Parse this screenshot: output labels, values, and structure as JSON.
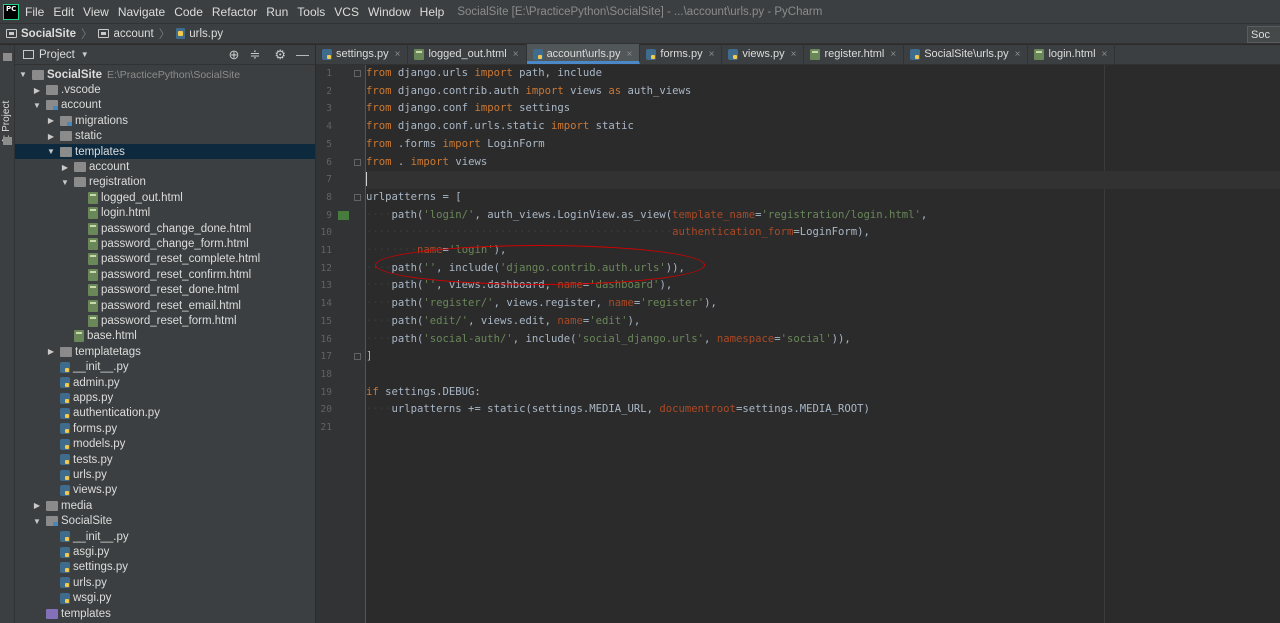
{
  "window": {
    "app_logo": "PC",
    "menu": [
      "File",
      "Edit",
      "View",
      "Navigate",
      "Code",
      "Refactor",
      "Run",
      "Tools",
      "VCS",
      "Window",
      "Help"
    ],
    "title": "SocialSite [E:\\PracticePython\\SocialSite] - ...\\account\\urls.py - PyCharm"
  },
  "navbar": {
    "project": "SocialSite",
    "folder": "account",
    "file": "urls.py",
    "right_label": "Soc"
  },
  "toolstrip": {
    "label": "1: Project"
  },
  "project_panel": {
    "header": "Project",
    "tree": [
      {
        "label": "SocialSite",
        "path": "E:\\PracticePython\\SocialSite",
        "type": "folder",
        "level": 0,
        "arrow": "down",
        "bold": true
      },
      {
        "label": ".vscode",
        "type": "folder",
        "level": 1,
        "arrow": "right"
      },
      {
        "label": "account",
        "type": "module",
        "level": 1,
        "arrow": "down"
      },
      {
        "label": "migrations",
        "type": "module",
        "level": 2,
        "arrow": "right"
      },
      {
        "label": "static",
        "type": "folder",
        "level": 2,
        "arrow": "right"
      },
      {
        "label": "templates",
        "type": "folder",
        "level": 2,
        "arrow": "down",
        "selected": true
      },
      {
        "label": "account",
        "type": "folder",
        "level": 3,
        "arrow": "right"
      },
      {
        "label": "registration",
        "type": "folder",
        "level": 3,
        "arrow": "down"
      },
      {
        "label": "logged_out.html",
        "type": "html",
        "level": 4
      },
      {
        "label": "login.html",
        "type": "html",
        "level": 4
      },
      {
        "label": "password_change_done.html",
        "type": "html",
        "level": 4
      },
      {
        "label": "password_change_form.html",
        "type": "html",
        "level": 4
      },
      {
        "label": "password_reset_complete.html",
        "type": "html",
        "level": 4
      },
      {
        "label": "password_reset_confirm.html",
        "type": "html",
        "level": 4
      },
      {
        "label": "password_reset_done.html",
        "type": "html",
        "level": 4
      },
      {
        "label": "password_reset_email.html",
        "type": "html",
        "level": 4
      },
      {
        "label": "password_reset_form.html",
        "type": "html",
        "level": 4
      },
      {
        "label": "base.html",
        "type": "html",
        "level": 3
      },
      {
        "label": "templatetags",
        "type": "folder",
        "level": 2,
        "arrow": "right"
      },
      {
        "label": "__init__.py",
        "type": "py",
        "level": 2
      },
      {
        "label": "admin.py",
        "type": "py",
        "level": 2
      },
      {
        "label": "apps.py",
        "type": "py",
        "level": 2
      },
      {
        "label": "authentication.py",
        "type": "py",
        "level": 2
      },
      {
        "label": "forms.py",
        "type": "py",
        "level": 2
      },
      {
        "label": "models.py",
        "type": "py",
        "level": 2
      },
      {
        "label": "tests.py",
        "type": "py",
        "level": 2
      },
      {
        "label": "urls.py",
        "type": "py",
        "level": 2
      },
      {
        "label": "views.py",
        "type": "py",
        "level": 2
      },
      {
        "label": "media",
        "type": "folder",
        "level": 1,
        "arrow": "right"
      },
      {
        "label": "SocialSite",
        "type": "module",
        "level": 1,
        "arrow": "down"
      },
      {
        "label": "__init__.py",
        "type": "py",
        "level": 2
      },
      {
        "label": "asgi.py",
        "type": "py",
        "level": 2
      },
      {
        "label": "settings.py",
        "type": "py",
        "level": 2
      },
      {
        "label": "urls.py",
        "type": "py",
        "level": 2
      },
      {
        "label": "wsgi.py",
        "type": "py",
        "level": 2
      },
      {
        "label": "templates",
        "type": "purple",
        "level": 1
      }
    ]
  },
  "tabs": [
    {
      "label": "settings.py",
      "type": "py"
    },
    {
      "label": "logged_out.html",
      "type": "html"
    },
    {
      "label": "account\\urls.py",
      "type": "py",
      "active": true
    },
    {
      "label": "forms.py",
      "type": "py"
    },
    {
      "label": "views.py",
      "type": "py"
    },
    {
      "label": "register.html",
      "type": "html"
    },
    {
      "label": "SocialSite\\urls.py",
      "type": "py"
    },
    {
      "label": "login.html",
      "type": "html"
    }
  ],
  "editor": {
    "lines": [
      [
        [
          "kw",
          "from"
        ],
        [
          "plain",
          " django.urls "
        ],
        [
          "kw",
          "import"
        ],
        [
          "plain",
          " path, include"
        ]
      ],
      [
        [
          "kw",
          "from"
        ],
        [
          "plain",
          " django.contrib.auth "
        ],
        [
          "kw",
          "import"
        ],
        [
          "plain",
          " views "
        ],
        [
          "kw",
          "as"
        ],
        [
          "plain",
          " auth_views"
        ]
      ],
      [
        [
          "kw",
          "from"
        ],
        [
          "plain",
          " django.conf "
        ],
        [
          "kw",
          "import"
        ],
        [
          "plain",
          " settings"
        ]
      ],
      [
        [
          "kw",
          "from"
        ],
        [
          "plain",
          " django.conf.urls.static "
        ],
        [
          "kw",
          "import"
        ],
        [
          "plain",
          " static"
        ]
      ],
      [
        [
          "kw",
          "from"
        ],
        [
          "plain",
          " .forms "
        ],
        [
          "kw",
          "import"
        ],
        [
          "plain",
          " LoginForm"
        ]
      ],
      [
        [
          "kw",
          "from"
        ],
        [
          "plain",
          " . "
        ],
        [
          "kw",
          "import"
        ],
        [
          "plain",
          " views"
        ]
      ],
      [],
      [
        [
          "plain",
          "urlpatterns = ["
        ]
      ],
      [
        [
          "dots",
          "····"
        ],
        [
          "plain",
          "path("
        ],
        [
          "str",
          "'login/'"
        ],
        [
          "plain",
          ", auth_views.LoginView.as_view("
        ],
        [
          "param",
          "template_name"
        ],
        [
          "plain",
          "="
        ],
        [
          "str",
          "'registration/login.html'"
        ],
        [
          "plain",
          ","
        ]
      ],
      [
        [
          "dots",
          "················································"
        ],
        [
          "param",
          "authentication_form"
        ],
        [
          "plain",
          "=LoginForm),"
        ]
      ],
      [
        [
          "dots",
          "········"
        ],
        [
          "param",
          "name"
        ],
        [
          "plain",
          "="
        ],
        [
          "str",
          "'login'"
        ],
        [
          "plain",
          "),"
        ]
      ],
      [
        [
          "dots",
          "····"
        ],
        [
          "plain",
          "path("
        ],
        [
          "str",
          "''"
        ],
        [
          "plain",
          ", include("
        ],
        [
          "str",
          "'django.contrib.auth.urls'"
        ],
        [
          "plain",
          ")),"
        ]
      ],
      [
        [
          "dots",
          "····"
        ],
        [
          "plain",
          "path("
        ],
        [
          "str",
          "''"
        ],
        [
          "plain",
          ", views.dashboard, "
        ],
        [
          "param",
          "name"
        ],
        [
          "plain",
          "="
        ],
        [
          "str",
          "'dashboard'"
        ],
        [
          "plain",
          "),"
        ]
      ],
      [
        [
          "dots",
          "····"
        ],
        [
          "plain",
          "path("
        ],
        [
          "str",
          "'register/'"
        ],
        [
          "plain",
          ", views.register, "
        ],
        [
          "param",
          "name"
        ],
        [
          "plain",
          "="
        ],
        [
          "str",
          "'register'"
        ],
        [
          "plain",
          "),"
        ]
      ],
      [
        [
          "dots",
          "····"
        ],
        [
          "plain",
          "path("
        ],
        [
          "str",
          "'edit/'"
        ],
        [
          "plain",
          ", views.edit, "
        ],
        [
          "param",
          "name"
        ],
        [
          "plain",
          "="
        ],
        [
          "str",
          "'edit'"
        ],
        [
          "plain",
          "),"
        ]
      ],
      [
        [
          "dots",
          "····"
        ],
        [
          "plain",
          "path("
        ],
        [
          "str",
          "'social-auth/'"
        ],
        [
          "plain",
          ", include("
        ],
        [
          "str",
          "'social_django.urls'"
        ],
        [
          "plain",
          ", "
        ],
        [
          "param",
          "namespace"
        ],
        [
          "plain",
          "="
        ],
        [
          "str",
          "'social'"
        ],
        [
          "plain",
          ")),"
        ]
      ],
      [
        [
          "plain",
          "]"
        ]
      ],
      [],
      [
        [
          "kw",
          "if"
        ],
        [
          "plain",
          " settings.DEBUG:"
        ]
      ],
      [
        [
          "dots",
          "····"
        ],
        [
          "plain",
          "urlpatterns += static(settings.MEDIA_URL, "
        ],
        [
          "param",
          "documentroot"
        ],
        [
          "plain",
          "=settings.MEDIA_ROOT)"
        ]
      ],
      []
    ],
    "current_line": 7
  }
}
